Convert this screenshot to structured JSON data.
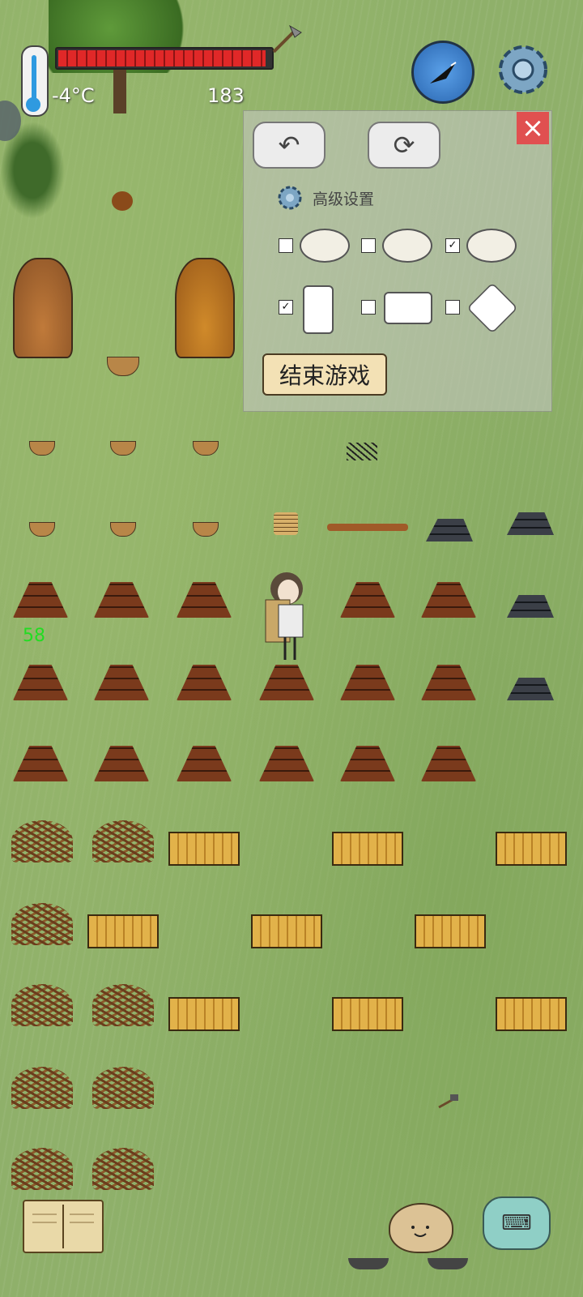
{
  "hud": {
    "temperature": "-4°C",
    "yum_count": "183",
    "steps": "58"
  },
  "settings_panel": {
    "back_icon": "undo-icon",
    "reset_icon": "refresh-icon",
    "close_icon": "close-icon",
    "title": "高级设置",
    "eye_options": [
      {
        "checked": false,
        "icon": "eye-front-icon"
      },
      {
        "checked": false,
        "icon": "eye-side-icon"
      },
      {
        "checked": true,
        "icon": "eye-back-icon"
      }
    ],
    "device_options": [
      {
        "checked": true,
        "icon": "phone-portrait-icon"
      },
      {
        "checked": false,
        "icon": "tablet-landscape-icon"
      },
      {
        "checked": false,
        "icon": "rotate-device-icon"
      }
    ],
    "end_game_label": "结束游戏"
  },
  "colors": {
    "grass": "#8fb06a",
    "food_bar": "#e02828",
    "steps_text": "#22dd22",
    "close_button": "#e05050"
  }
}
